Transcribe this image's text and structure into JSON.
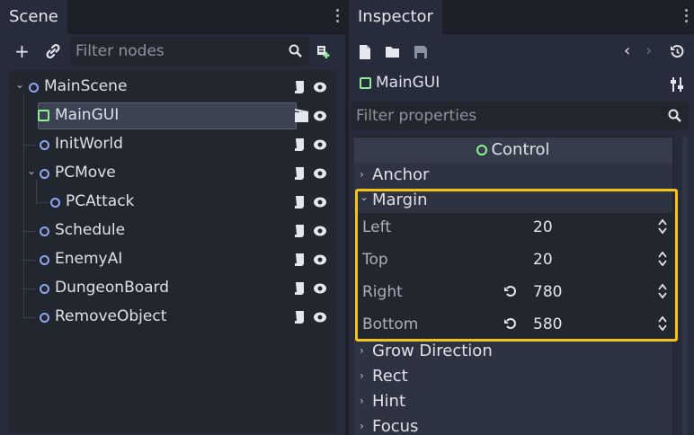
{
  "colors": {
    "accent_highlight": "#f4c21b",
    "node_icon": "#8da5f3",
    "control_icon": "#8eef97"
  },
  "scene": {
    "tab_label": "Scene",
    "filter_placeholder": "Filter nodes",
    "nodes": [
      {
        "label": "MainScene",
        "icon": "node-circle-icon"
      },
      {
        "label": "MainGUI",
        "icon": "control-icon",
        "selected": true
      },
      {
        "label": "InitWorld",
        "icon": "node-circle-icon"
      },
      {
        "label": "PCMove",
        "icon": "node-circle-icon"
      },
      {
        "label": "PCAttack",
        "icon": "node-circle-icon"
      },
      {
        "label": "Schedule",
        "icon": "node-circle-icon"
      },
      {
        "label": "EnemyAI",
        "icon": "node-circle-icon"
      },
      {
        "label": "DungeonBoard",
        "icon": "node-circle-icon"
      },
      {
        "label": "RemoveObject",
        "icon": "node-circle-icon"
      }
    ]
  },
  "inspector": {
    "tab_label": "Inspector",
    "node_name": "MainGUI",
    "filter_placeholder": "Filter properties",
    "section_title": "Control",
    "categories": {
      "anchor": "Anchor",
      "margin": "Margin",
      "grow_direction": "Grow Direction",
      "rect": "Rect",
      "hint": "Hint",
      "focus": "Focus"
    },
    "margin_props": [
      {
        "label": "Left",
        "value": "20",
        "reverted": false
      },
      {
        "label": "Top",
        "value": "20",
        "reverted": false
      },
      {
        "label": "Right",
        "value": "780",
        "reverted": true
      },
      {
        "label": "Bottom",
        "value": "580",
        "reverted": true
      }
    ]
  }
}
